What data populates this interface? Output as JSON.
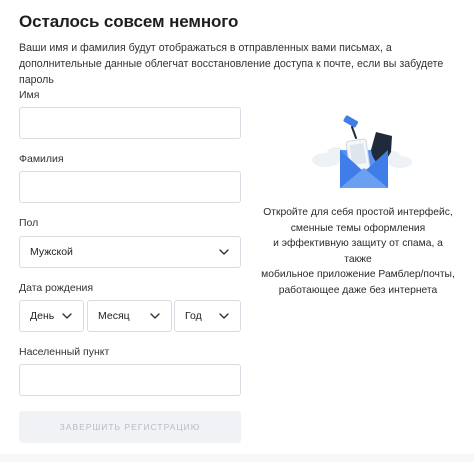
{
  "header": {
    "title": "Осталось совсем немного",
    "subtitle": "Ваши имя и фамилия будут отображаться в отправленных вами письмах, а дополнительные данные облегчат восстановление доступа к почте, если вы забудете пароль"
  },
  "form": {
    "first_name": {
      "label": "Имя",
      "value": "",
      "placeholder": ""
    },
    "last_name": {
      "label": "Фамилия",
      "value": "",
      "placeholder": ""
    },
    "gender": {
      "label": "Пол",
      "value": "Мужской"
    },
    "birth_date": {
      "label": "Дата рождения",
      "day": "День",
      "month": "Месяц",
      "year": "Год"
    },
    "city": {
      "label": "Населенный пункт",
      "value": "",
      "placeholder": ""
    },
    "submit_label": "ЗАВЕРШИТЬ РЕГИСТРАЦИЮ"
  },
  "promo": {
    "illustration_icon": "envelope-with-phone-and-shield-icon",
    "line1": "Откройте для себя простой интерфейс,",
    "line2": "сменные темы оформления",
    "line3": "и эффективную защиту от спама, а также",
    "line4": "мобильное приложение Рамблер/почты,",
    "line5": "работающее даже без интернета"
  },
  "colors": {
    "accent_blue": "#3f7ee8",
    "field_border": "#d8dde3",
    "disabled_button_bg": "#f0f2f5",
    "disabled_button_text": "#b4bcc6"
  }
}
